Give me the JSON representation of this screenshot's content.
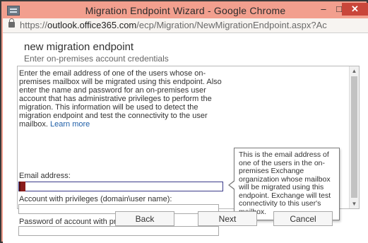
{
  "window": {
    "title": "Migration Endpoint Wizard - Google Chrome",
    "minimize_glyph": "–",
    "maximize_glyph": "□",
    "close_glyph": "✕"
  },
  "address_bar": {
    "scheme": "https://",
    "domain": "outlook.office365.com",
    "path": "/ecp/Migration/NewMigrationEndpoint.aspx?Ac"
  },
  "page": {
    "title": "new migration endpoint",
    "subtitle": "Enter on-premises account credentials"
  },
  "instructions": {
    "text": "Enter the email address of one of the users whose on-premises mailbox will be migrated using this endpoint. Also enter the name and password for an on-premises user account that has administrative privileges to perform the migration. This information will be used to detect the migration endpoint and test the connectivity to the user mailbox.",
    "learn_more": "Learn more"
  },
  "form": {
    "email_label": "Email address:",
    "email_value": "",
    "account_label": "Account with privileges (domain\\user name):",
    "account_value": "",
    "password_label": "Password of account with privileges:",
    "password_value": ""
  },
  "tooltip": {
    "text": "This is the email address of one of the users in the on-premises Exchange organization whose mailbox will be migrated using this endpoint. Exchange will test connectivity to this user's mailbox."
  },
  "scrollbar": {
    "up_glyph": "▲",
    "down_glyph": "▼"
  },
  "buttons": {
    "back": "Back",
    "next": "Next",
    "cancel": "Cancel"
  },
  "colors": {
    "titlebar": "#f29f8e",
    "close_button": "#c9463a",
    "link": "#1f5fa8",
    "active_field_marker": "#8a1c1c"
  },
  "icons": {
    "app": "window-app-icon",
    "lock": "lock-icon"
  }
}
